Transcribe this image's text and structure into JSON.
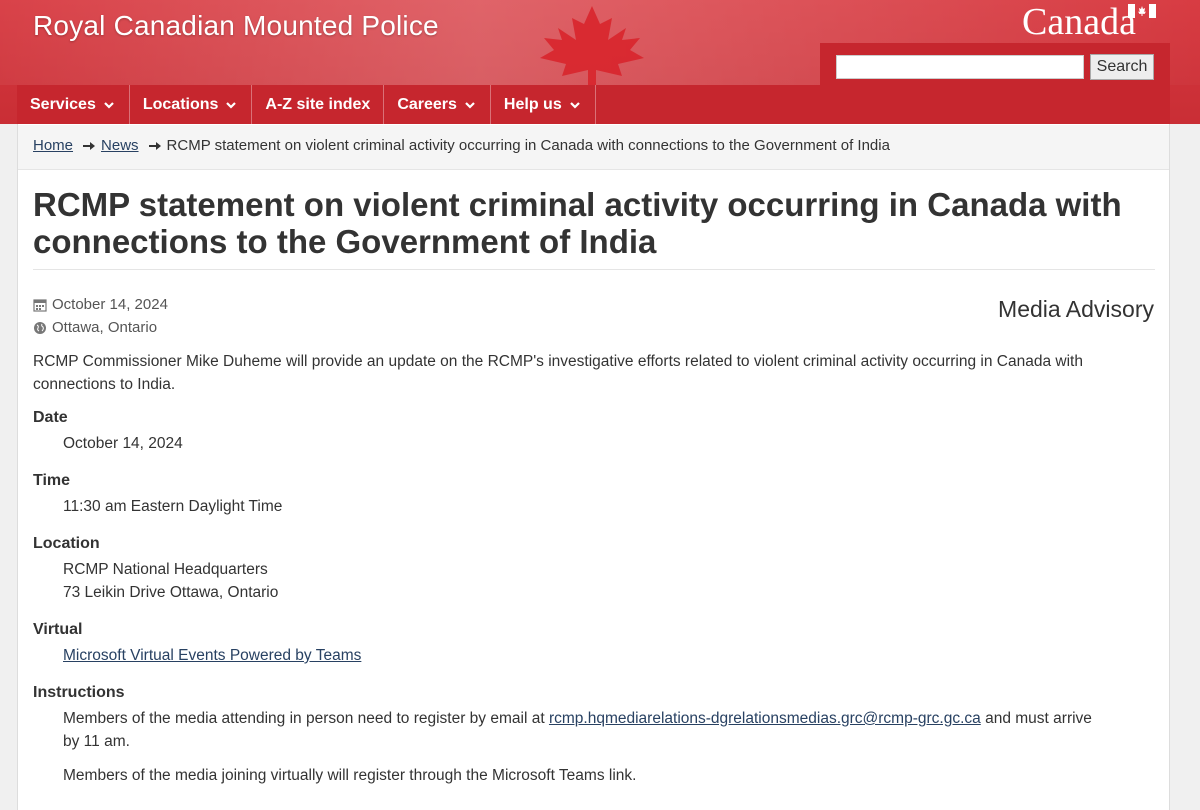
{
  "header": {
    "site_title": "Royal Canadian Mounted Police",
    "wordmark": "Canada",
    "search_placeholder": "",
    "search_button": "Search",
    "colors": {
      "banner_red": "#c6262e",
      "link": "#284162"
    }
  },
  "menu": [
    {
      "label": "Services",
      "has_dropdown": true
    },
    {
      "label": "Locations",
      "has_dropdown": true
    },
    {
      "label": "A-Z site index",
      "has_dropdown": false
    },
    {
      "label": "Careers",
      "has_dropdown": true
    },
    {
      "label": "Help us",
      "has_dropdown": true
    }
  ],
  "breadcrumb": {
    "home": "Home",
    "news": "News",
    "current": "RCMP statement on violent criminal activity occurring in Canada with connections to the Government of India"
  },
  "article": {
    "title": "RCMP statement on violent criminal activity occurring in Canada with connections to the Government of India",
    "date": "October 14, 2024",
    "location": "Ottawa, Ontario",
    "type": "Media Advisory",
    "intro": "RCMP Commissioner Mike Duheme will provide an update on the RCMP's investigative efforts related to violent criminal activity occurring in Canada with connections to India."
  },
  "details": {
    "date_label": "Date",
    "date_value": "October 14, 2024",
    "time_label": "Time",
    "time_value": "11:30 am Eastern Daylight Time",
    "location_label": "Location",
    "location_line1": "RCMP National Headquarters",
    "location_line2": "73 Leikin Drive Ottawa, Ontario",
    "virtual_label": "Virtual",
    "virtual_link": "Microsoft Virtual Events Powered by Teams",
    "instructions_label": "Instructions",
    "instructions_pre": "Members of the media attending in person need to register by email at",
    "instructions_email": "rcmp.hqmediarelations-dgrelationsmedias.grc@rcmp-grc.gc.ca",
    "instructions_post": "and must arrive",
    "instructions_line2": "by 11 am.",
    "instructions_virtual": "Members of the media joining virtually will register through the Microsoft Teams link."
  }
}
